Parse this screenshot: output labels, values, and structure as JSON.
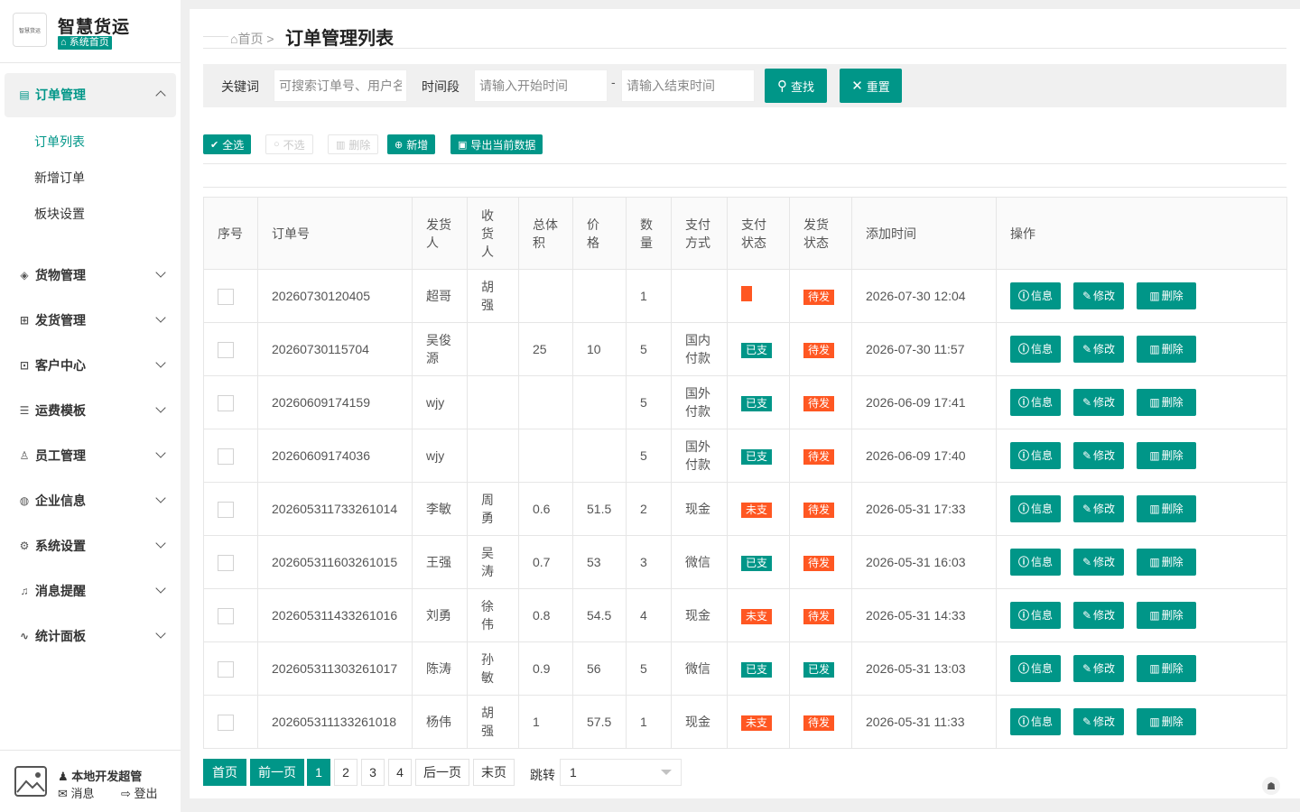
{
  "brand": {
    "logo_text": "智慧货运",
    "title": "智慧货运",
    "home_badge": "系统首页",
    "home_icon": "home-icon"
  },
  "nav": {
    "items": [
      {
        "label": "订单管理",
        "icon": "file-icon",
        "glyph": "▤",
        "open": true
      },
      {
        "label": "货物管理",
        "icon": "stack-icon",
        "glyph": "◈"
      },
      {
        "label": "发货管理",
        "icon": "truck-icon",
        "glyph": "⊞"
      },
      {
        "label": "客户中心",
        "icon": "grid-icon",
        "glyph": "⊡"
      },
      {
        "label": "运费模板",
        "icon": "sliders-icon",
        "glyph": "☰"
      },
      {
        "label": "员工管理",
        "icon": "user-icon",
        "glyph": "♙"
      },
      {
        "label": "企业信息",
        "icon": "globe-icon",
        "glyph": "◍"
      },
      {
        "label": "系统设置",
        "icon": "gear-icon",
        "glyph": "⚙"
      },
      {
        "label": "消息提醒",
        "icon": "bell-icon",
        "glyph": "♫"
      },
      {
        "label": "统计面板",
        "icon": "pulse-icon",
        "glyph": "∿"
      }
    ],
    "sub_items": [
      "订单列表",
      "新增订单",
      "板块设置"
    ],
    "active_sub": "订单列表"
  },
  "user": {
    "name": "本地开发超管",
    "messages": "消息",
    "logout": "登出"
  },
  "breadcrumb": {
    "home": "首页",
    "separator": ">",
    "current": "订单管理列表"
  },
  "search": {
    "keyword_label": "关键词",
    "keyword_placeholder": "可搜索订单号、用户名、",
    "period_label": "时间段",
    "start_placeholder": "请输入开始时间",
    "dash": "-",
    "end_placeholder": "请输入结束时间",
    "search_button": "查找",
    "reset_button": "重置"
  },
  "toolbar": {
    "select_all": "全选",
    "deselect": "不选",
    "delete": "删除",
    "add": "新增",
    "export": "导出当前数据"
  },
  "table": {
    "headers": [
      "序号",
      "订单号",
      "发货人",
      "收货人",
      "总体积",
      "价格",
      "数量",
      "支付方式",
      "支付状态",
      "发货状态",
      "添加时间",
      "操作"
    ],
    "header_lines": [
      [
        "序号"
      ],
      [
        "订单号"
      ],
      [
        "发货",
        "人"
      ],
      [
        "收",
        "货",
        "人"
      ],
      [
        "总体",
        "积"
      ],
      [
        "价",
        "格"
      ],
      [
        "数",
        "量"
      ],
      [
        "支付",
        "方式"
      ],
      [
        "支付",
        "状态"
      ],
      [
        "发货",
        "状态"
      ],
      [
        "添加时间"
      ],
      [
        "操作"
      ]
    ],
    "op_labels": {
      "info": "信息",
      "edit": "修改",
      "delete": "删除"
    },
    "rows": [
      {
        "order": "20260730120405",
        "sender": [
          "超哥"
        ],
        "receiver": [
          "胡",
          "强"
        ],
        "volume": "",
        "price": "",
        "qty": "1",
        "pay_method": [],
        "pay_status": "",
        "pay_color": "orange",
        "ship_status": "待发",
        "ship_color": "orange",
        "time": "2026-07-30 12:04"
      },
      {
        "order": "20260730115704",
        "sender": [
          "吴俊",
          "源"
        ],
        "receiver": [],
        "volume": "25",
        "price": "10",
        "qty": "5",
        "pay_method": [
          "国内",
          "付款"
        ],
        "pay_status": "已支",
        "pay_color": "green",
        "ship_status": "待发",
        "ship_color": "orange",
        "time": "2026-07-30 11:57"
      },
      {
        "order": "20260609174159",
        "sender": [
          "wjy"
        ],
        "receiver": [],
        "volume": "",
        "price": "",
        "qty": "5",
        "pay_method": [
          "国外",
          "付款"
        ],
        "pay_status": "已支",
        "pay_color": "green",
        "ship_status": "待发",
        "ship_color": "orange",
        "time": "2026-06-09 17:41"
      },
      {
        "order": "20260609174036",
        "sender": [
          "wjy"
        ],
        "receiver": [],
        "volume": "",
        "price": "",
        "qty": "5",
        "pay_method": [
          "国外",
          "付款"
        ],
        "pay_status": "已支",
        "pay_color": "green",
        "ship_status": "待发",
        "ship_color": "orange",
        "time": "2026-06-09 17:40"
      },
      {
        "order": "202605311733261014",
        "sender": [
          "李敏"
        ],
        "receiver": [
          "周",
          "勇"
        ],
        "volume": "0.6",
        "price": "51.5",
        "qty": "2",
        "pay_method": [
          "现金"
        ],
        "pay_status": "未支",
        "pay_color": "orange",
        "ship_status": "待发",
        "ship_color": "orange",
        "time": "2026-05-31 17:33"
      },
      {
        "order": "202605311603261015",
        "sender": [
          "王强"
        ],
        "receiver": [
          "吴",
          "涛"
        ],
        "volume": "0.7",
        "price": "53",
        "qty": "3",
        "pay_method": [
          "微信"
        ],
        "pay_status": "已支",
        "pay_color": "green",
        "ship_status": "待发",
        "ship_color": "orange",
        "time": "2026-05-31 16:03"
      },
      {
        "order": "202605311433261016",
        "sender": [
          "刘勇"
        ],
        "receiver": [
          "徐",
          "伟"
        ],
        "volume": "0.8",
        "price": "54.5",
        "qty": "4",
        "pay_method": [
          "现金"
        ],
        "pay_status": "未支",
        "pay_color": "orange",
        "ship_status": "待发",
        "ship_color": "orange",
        "time": "2026-05-31 14:33"
      },
      {
        "order": "202605311303261017",
        "sender": [
          "陈涛"
        ],
        "receiver": [
          "孙",
          "敏"
        ],
        "volume": "0.9",
        "price": "56",
        "qty": "5",
        "pay_method": [
          "微信"
        ],
        "pay_status": "已支",
        "pay_color": "green",
        "ship_status": "已发",
        "ship_color": "green",
        "time": "2026-05-31 13:03"
      },
      {
        "order": "202605311133261018",
        "sender": [
          "杨伟"
        ],
        "receiver": [
          "胡",
          "强"
        ],
        "volume": "1",
        "price": "57.5",
        "qty": "1",
        "pay_method": [
          "现金"
        ],
        "pay_status": "未支",
        "pay_color": "orange",
        "ship_status": "待发",
        "ship_color": "orange",
        "time": "2026-05-31 11:33"
      }
    ]
  },
  "pagination": {
    "first": "首页",
    "prev": "前一页",
    "pages": [
      "1",
      "2",
      "3",
      "4"
    ],
    "current_page": "1",
    "next": "后一页",
    "last": "末页",
    "jump_label": "跳转",
    "jump_value": "1"
  },
  "colors": {
    "primary": "#009688",
    "warn": "#ff5722"
  }
}
